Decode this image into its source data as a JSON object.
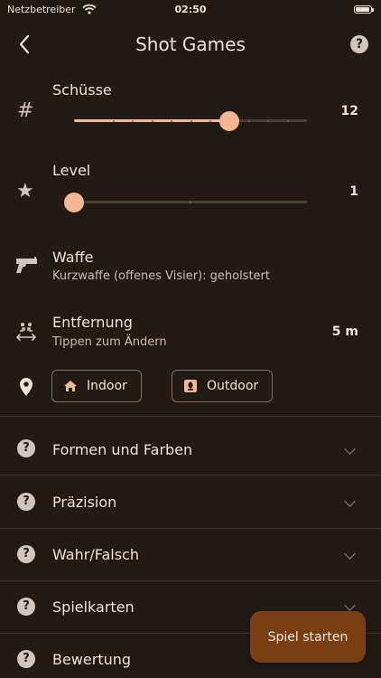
{
  "status_bar": {
    "carrier": "Netzbetreiber",
    "time": "02:50"
  },
  "header": {
    "back_icon": "chevron-left-icon",
    "title": "Shot Games",
    "help_icon": "question-circle-icon",
    "help_glyph": "?"
  },
  "settings": {
    "shots": {
      "label": "Schüsse",
      "icon": "hash-icon",
      "glyph": "#",
      "value": "12",
      "slider_fraction": 0.68
    },
    "level": {
      "label": "Level",
      "icon": "star-icon",
      "glyph": "★",
      "value": "1",
      "slider_fraction": 0.0
    },
    "weapon": {
      "label": "Waffe",
      "icon": "pistol-icon",
      "subtitle": "Kurzwaffe (offenes Visier): geholstert"
    },
    "distance": {
      "label": "Entfernung",
      "icon": "distance-icon",
      "subtitle": "Tippen zum Ändern",
      "value": "5 m"
    },
    "location": {
      "icon": "location-pin-icon",
      "options": [
        {
          "label": "Indoor",
          "icon": "house-icon"
        },
        {
          "label": "Outdoor",
          "icon": "outdoor-icon"
        }
      ]
    }
  },
  "games": [
    {
      "label": "Formen und Farben",
      "glyph": "?"
    },
    {
      "label": "Präzision",
      "glyph": "?"
    },
    {
      "label": "Wahr/Falsch",
      "glyph": "?"
    },
    {
      "label": "Spielkarten",
      "glyph": "?"
    },
    {
      "label": "Bewertung",
      "glyph": "?"
    }
  ],
  "start_button": {
    "label": "Spiel starten"
  },
  "colors": {
    "background": "#221a15",
    "accent": "#f3b794",
    "button": "#7a3e14",
    "text": "#ece3da"
  }
}
